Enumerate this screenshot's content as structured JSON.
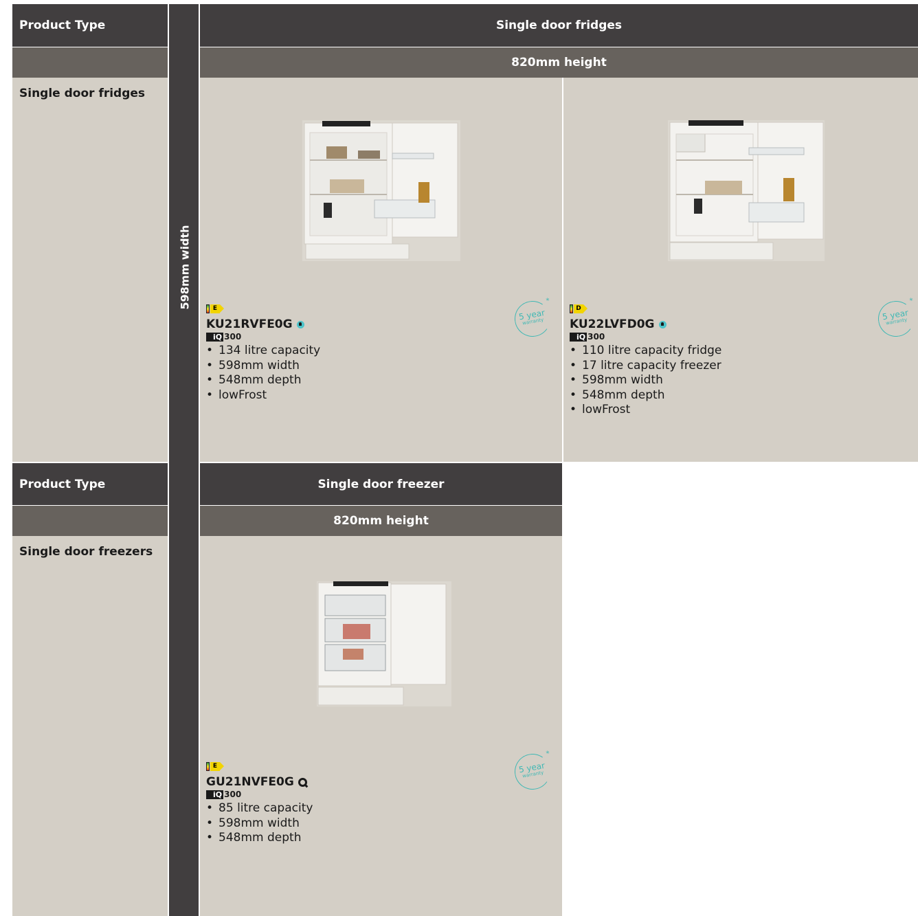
{
  "section1": {
    "product_type_label": "Product Type",
    "category_header": "Single door fridges",
    "height_label": "820mm height",
    "row_label": "Single door fridges",
    "width_label": "598mm width",
    "products": [
      {
        "energy_class": "E",
        "model": "KU21RVFE0G",
        "icon": "teal-dot-icon",
        "series": "300",
        "series_badge": "iQ",
        "specs": [
          "134 litre capacity",
          "598mm width",
          "548mm depth",
          "lowFrost"
        ],
        "warranty_years": "5 year",
        "warranty_word": "warranty",
        "warranty_mark": "*"
      },
      {
        "energy_class": "D",
        "model": "KU22LVFD0G",
        "icon": "teal-dot-icon",
        "series": "300",
        "series_badge": "iQ",
        "specs": [
          "110 litre capacity fridge",
          "17 litre capacity freezer",
          "598mm width",
          "548mm depth",
          "lowFrost"
        ],
        "warranty_years": "5 year",
        "warranty_word": "warranty",
        "warranty_mark": "*"
      }
    ]
  },
  "section2": {
    "product_type_label": "Product Type",
    "category_header": "Single door freezer",
    "height_label": "820mm height",
    "row_label": "Single door freezers",
    "products": [
      {
        "energy_class": "E",
        "model": "GU21NVFE0G",
        "icon": "q-search-icon",
        "series": "300",
        "series_badge": "iQ",
        "specs": [
          "85 litre capacity",
          "598mm width",
          "548mm depth"
        ],
        "warranty_years": "5 year",
        "warranty_word": "warranty",
        "warranty_mark": "*"
      }
    ]
  },
  "colors": {
    "dark_header": "#413e3f",
    "mid_header": "#67625d",
    "cell_background": "#d4cfc6",
    "warranty_teal": "#3fb8b4"
  }
}
